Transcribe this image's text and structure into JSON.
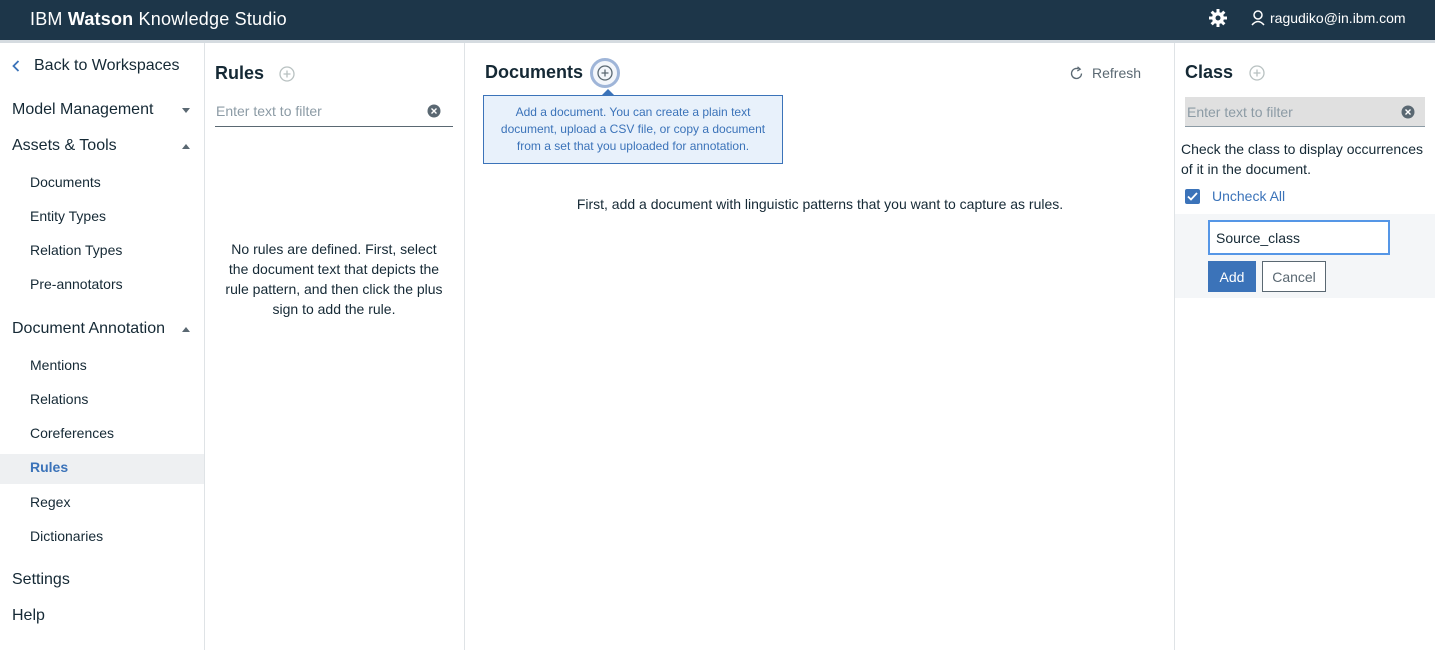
{
  "header": {
    "brand_prefix": "IBM",
    "brand_bold": "Watson",
    "brand_suffix": "Knowledge Studio",
    "user_email": "ragudiko@in.ibm.com"
  },
  "nav": {
    "back_label": "Back to Workspaces",
    "sections": [
      {
        "label": "Model Management"
      },
      {
        "label": "Assets & Tools",
        "items": [
          "Documents",
          "Entity Types",
          "Relation Types",
          "Pre-annotators"
        ]
      },
      {
        "label": "Document Annotation",
        "items": [
          "Mentions",
          "Relations",
          "Coreferences",
          "Rules",
          "Regex",
          "Dictionaries"
        ]
      },
      {
        "label": "Settings"
      },
      {
        "label": "Help"
      }
    ],
    "active_item": "Rules"
  },
  "rules_panel": {
    "title": "Rules",
    "filter_placeholder": "Enter text to filter",
    "empty_message": "No rules are defined. First, select the document text that depicts the rule pattern, and then click the plus sign to add the rule."
  },
  "documents_panel": {
    "title": "Documents",
    "tooltip": "Add a document. You can create a plain text document, upload a CSV file, or copy a document from a set that you uploaded for annotation.",
    "refresh_label": "Refresh",
    "message": "First, add a document with linguistic patterns that you want to capture as rules."
  },
  "class_panel": {
    "title": "Class",
    "filter_placeholder": "Enter text to filter",
    "help_text": "Check the class to display occurrences of it in the document.",
    "uncheck_label": "Uncheck All",
    "new_class_value": "Source_class",
    "add_label": "Add",
    "cancel_label": "Cancel"
  },
  "colors": {
    "header_bg": "#1d3649",
    "accent": "#3b73b9",
    "tooltip_bg": "#e8f1fb"
  }
}
